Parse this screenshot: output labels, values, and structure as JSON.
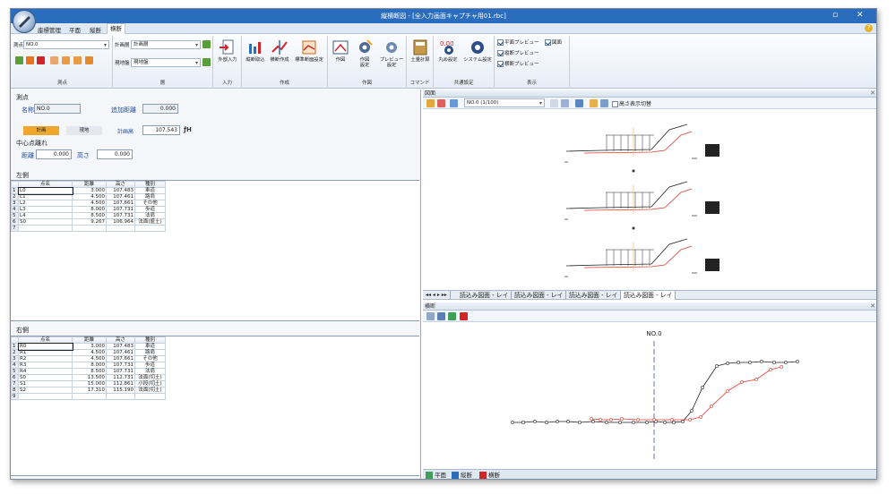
{
  "window": {
    "title": "縦横断図 - [全入力画面キャプチャ用01.rbc]",
    "restore_icon": "restore-icon",
    "close_icon": "close-icon"
  },
  "menu": [
    "座標管理",
    "平面",
    "縦断",
    "横断"
  ],
  "ribbon": {
    "measure": {
      "combo1_label": "測点",
      "combo1_value": "NO.0",
      "group_label": "測点"
    },
    "layer": {
      "combo1_label": "計画層",
      "combo1_value": "計画層",
      "combo2_label": "現地盤",
      "combo2_value": "現地盤",
      "group_label": "層"
    },
    "input": {
      "btn": "外部入力",
      "group_label": "入力"
    },
    "create": {
      "btn1": "縦断取込",
      "btn2": "横断作成",
      "btn3": "標準断面設定",
      "group_label": "作成"
    },
    "draw": {
      "btn1": "作図",
      "btn2": "作図\n設定",
      "btn3": "プレビュー\n設定",
      "group_label": "作図"
    },
    "command": {
      "btn1": "土量計算",
      "group_label": "コマンド"
    },
    "common": {
      "btn1": "丸め設定",
      "btn2": "システム設定",
      "group_label": "共通設定"
    },
    "display": {
      "chk1": "平面プレビュー",
      "chk2": "図面",
      "chk3": "縦断プレビュー",
      "chk4": "横断プレビュー",
      "group_label": "表示"
    }
  },
  "left": {
    "section": "測点",
    "name_label": "名称",
    "name_value": "NO.0",
    "add_dist_label": "追加距離",
    "add_dist_value": "0.000",
    "tab1": "計画",
    "tab2": "現地",
    "plan_height_label": "計画高",
    "plan_height_value": "107.543",
    "center_section": "中心点離れ",
    "dist_label": "距離",
    "dist_value": "0.000",
    "height_label": "高さ",
    "height_value": "0.000",
    "left_title": "左側",
    "right_title": "右側",
    "columns": [
      "点名",
      "距離",
      "高さ",
      "種別"
    ],
    "left_rows": [
      [
        "1",
        "L0",
        "3.000",
        "107.483",
        "車道"
      ],
      [
        "2",
        "L1",
        "4.500",
        "107.461",
        "路肩"
      ],
      [
        "3",
        "L2",
        "4.500",
        "107.661",
        "その他"
      ],
      [
        "4",
        "L3",
        "8.000",
        "107.731",
        "歩道"
      ],
      [
        "5",
        "L4",
        "8.500",
        "107.731",
        "法肩"
      ],
      [
        "6",
        "S0",
        "9.267",
        "106.964",
        "法面(盛土)"
      ],
      [
        "7",
        "",
        "",
        "",
        ""
      ]
    ],
    "right_rows": [
      [
        "1",
        "R0",
        "3.000",
        "107.483",
        "車道"
      ],
      [
        "2",
        "R1",
        "4.500",
        "107.461",
        "路肩"
      ],
      [
        "3",
        "R2",
        "4.500",
        "107.661",
        "その他"
      ],
      [
        "4",
        "R3",
        "8.000",
        "107.731",
        "歩道"
      ],
      [
        "5",
        "R4",
        "8.500",
        "107.731",
        "法肩"
      ],
      [
        "6",
        "S0",
        "13.500",
        "112.731",
        "法面(切土)"
      ],
      [
        "7",
        "S1",
        "15.000",
        "112.861",
        "小段(切土)"
      ],
      [
        "8",
        "S2",
        "17.310",
        "115.190",
        "法面(切土)"
      ],
      [
        "9",
        "",
        "",
        "",
        ""
      ]
    ]
  },
  "drawing_panel": {
    "title": "図面",
    "combo_value": "NO.0 (1/100)",
    "toggle_label": "高さ表示切替",
    "sheet_tabs": [
      "読込み図面 - レイ",
      "読込み図面 - レイ",
      "読込み図面 - レイ",
      "読込み図面 - レイ"
    ]
  },
  "cross_panel": {
    "title": "横断",
    "station_label": "NO.0"
  },
  "footer_tabs": [
    "平面",
    "縦断",
    "横断"
  ],
  "colors": {
    "titlebar": "#2b6dbd",
    "plan_line": "#e23b2e",
    "ground_line": "#222222",
    "centerline": "#1f3f8f"
  }
}
